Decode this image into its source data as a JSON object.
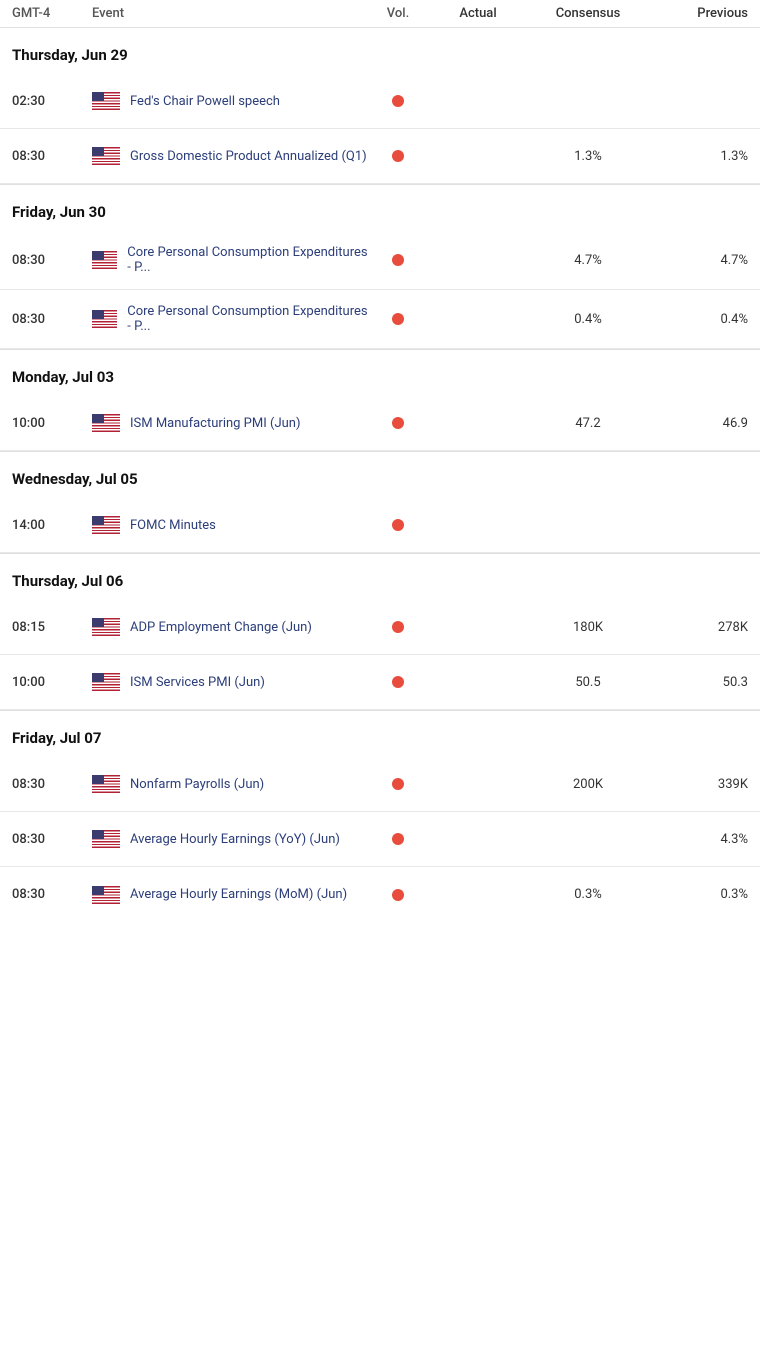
{
  "header": {
    "timezone": "GMT-4",
    "event": "Event",
    "vol": "Vol.",
    "actual": "Actual",
    "consensus": "Consensus",
    "previous": "Previous"
  },
  "sections": [
    {
      "date": "Thursday, Jun 29",
      "events": [
        {
          "time": "02:30",
          "name": "Fed's Chair Powell speech",
          "has_vol": true,
          "actual": "",
          "consensus": "",
          "previous": ""
        },
        {
          "time": "08:30",
          "name": "Gross Domestic Product Annualized (Q1)",
          "has_vol": true,
          "actual": "",
          "consensus": "1.3%",
          "previous": "1.3%"
        }
      ]
    },
    {
      "date": "Friday, Jun 30",
      "events": [
        {
          "time": "08:30",
          "name": "Core Personal Consumption Expenditures - P...",
          "has_vol": true,
          "actual": "",
          "consensus": "4.7%",
          "previous": "4.7%"
        },
        {
          "time": "08:30",
          "name": "Core Personal Consumption Expenditures - P...",
          "has_vol": true,
          "actual": "",
          "consensus": "0.4%",
          "previous": "0.4%"
        }
      ]
    },
    {
      "date": "Monday, Jul 03",
      "events": [
        {
          "time": "10:00",
          "name": "ISM Manufacturing PMI (Jun)",
          "has_vol": true,
          "actual": "",
          "consensus": "47.2",
          "previous": "46.9"
        }
      ]
    },
    {
      "date": "Wednesday, Jul 05",
      "events": [
        {
          "time": "14:00",
          "name": "FOMC Minutes",
          "has_vol": true,
          "actual": "",
          "consensus": "",
          "previous": ""
        }
      ]
    },
    {
      "date": "Thursday, Jul 06",
      "events": [
        {
          "time": "08:15",
          "name": "ADP Employment Change (Jun)",
          "has_vol": true,
          "actual": "",
          "consensus": "180K",
          "previous": "278K"
        },
        {
          "time": "10:00",
          "name": "ISM Services PMI (Jun)",
          "has_vol": true,
          "actual": "",
          "consensus": "50.5",
          "previous": "50.3"
        }
      ]
    },
    {
      "date": "Friday, Jul 07",
      "events": [
        {
          "time": "08:30",
          "name": "Nonfarm Payrolls (Jun)",
          "has_vol": true,
          "actual": "",
          "consensus": "200K",
          "previous": "339K"
        },
        {
          "time": "08:30",
          "name": "Average Hourly Earnings (YoY) (Jun)",
          "has_vol": true,
          "actual": "",
          "consensus": "",
          "previous": "4.3%"
        },
        {
          "time": "08:30",
          "name": "Average Hourly Earnings (MoM) (Jun)",
          "has_vol": true,
          "actual": "",
          "consensus": "0.3%",
          "previous": "0.3%"
        }
      ]
    }
  ]
}
